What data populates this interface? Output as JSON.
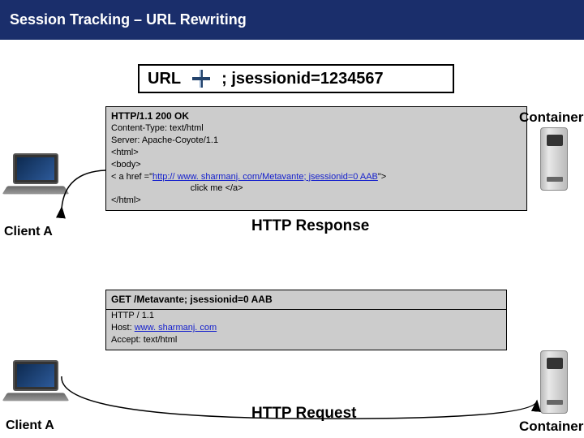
{
  "header": {
    "title": "Session Tracking – URL Rewriting"
  },
  "url": {
    "label": "URL",
    "param": "; jsessionid=1234567"
  },
  "response_panel": {
    "status": "HTTP/1.1 200 OK",
    "h1": "Content-Type: text/html",
    "h2": "Server: Apache-Coyote/1.1",
    "l1": "<html>",
    "l2": "  <body>",
    "l3a": "    < a href =\"",
    "l3b": "http:// www. sharmanj. com/Metavante; jsessionid=0 AAB",
    "l3c": "\">",
    "l4": "                                click me </a>",
    "l5": "</html>"
  },
  "request_panel": {
    "getline": "GET /Metavante; jsessionid=0 AAB",
    "h1": "HTTP / 1.1",
    "h2a": "Host: ",
    "h2b": "www. sharmanj. com",
    "h3": "Accept: text/html"
  },
  "labels": {
    "clientA": "Client A",
    "container": "Container",
    "httpResponse": "HTTP Response",
    "httpRequest": "HTTP Request"
  }
}
